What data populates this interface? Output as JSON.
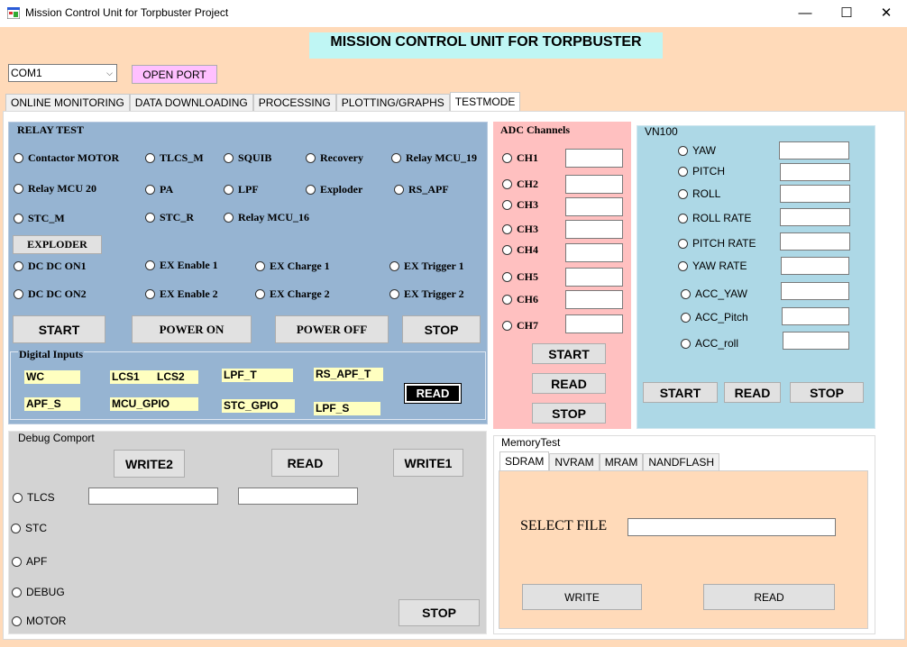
{
  "window": {
    "title": "Mission Control Unit for Torpbuster Project",
    "minimize": "—",
    "maximize": "☐",
    "close": "✕"
  },
  "banner": "MISSION CONTROL UNIT FOR TORPBUSTER",
  "port": {
    "selected": "COM1",
    "open_label": "OPEN PORT"
  },
  "tabs": [
    "ONLINE MONITORING",
    "DATA DOWNLOADING",
    "PROCESSING",
    "PLOTTING/GRAPHS",
    "TESTMODE"
  ],
  "relay": {
    "title": "RELAY TEST",
    "radios": [
      "Contactor MOTOR",
      "TLCS_M",
      "SQUIB",
      "Recovery",
      "Relay MCU_19",
      "Relay MCU 20",
      "PA",
      "LPF",
      "Exploder",
      "RS_APF",
      "STC_M",
      "STC_R",
      "Relay MCU_16"
    ],
    "exploder_btn": "EXPLODER",
    "ex_radios": [
      "DC DC ON1",
      "EX Enable 1",
      "EX Charge 1",
      "EX Trigger 1",
      "DC DC ON2",
      "EX Enable 2",
      "EX Charge 2",
      "EX Trigger 2"
    ],
    "buttons": {
      "start": "START",
      "power_on": "POWER ON",
      "power_off": "POWER OFF",
      "stop": "STOP"
    },
    "digital_title": "Digital Inputs",
    "digital": [
      "WC",
      "LCS1",
      "LCS2",
      "LPF_T",
      "RS_APF_T",
      "APF_S",
      "MCU_GPIO",
      "STC_GPIO",
      "LPF_S"
    ],
    "read": "READ"
  },
  "adc": {
    "title": "ADC Channels",
    "channels": [
      "CH1",
      "CH2",
      "CH3",
      "CH3",
      "CH4",
      "CH5",
      "CH6",
      "CH7"
    ],
    "start": "START",
    "read": "READ",
    "stop": "STOP"
  },
  "vn100": {
    "title": "VN100",
    "radios": [
      "YAW",
      "PITCH",
      "ROLL",
      "ROLL RATE",
      "PITCH RATE",
      "YAW RATE",
      "ACC_YAW",
      "ACC_Pitch",
      "ACC_roll"
    ],
    "start": "START",
    "read": "READ",
    "stop": "STOP"
  },
  "debug": {
    "title": "Debug Comport",
    "write2": "WRITE2",
    "read": "READ",
    "write1": "WRITE1",
    "radios": [
      "TLCS",
      "STC",
      "APF",
      "DEBUG",
      "MOTOR"
    ],
    "stop": "STOP"
  },
  "memory": {
    "title": "MemoryTest",
    "tabs": [
      "SDRAM",
      "NVRAM",
      "MRAM",
      "NANDFLASH"
    ],
    "select_file": "SELECT FILE",
    "write": "WRITE",
    "read": "READ"
  },
  "colors": {
    "relay_bg": "#96b4d2",
    "adc_bg": "#ffc0c0",
    "vn_bg": "#add8e6",
    "debug_bg": "#d3d3d3",
    "memory_bg": "#ffdab9"
  }
}
